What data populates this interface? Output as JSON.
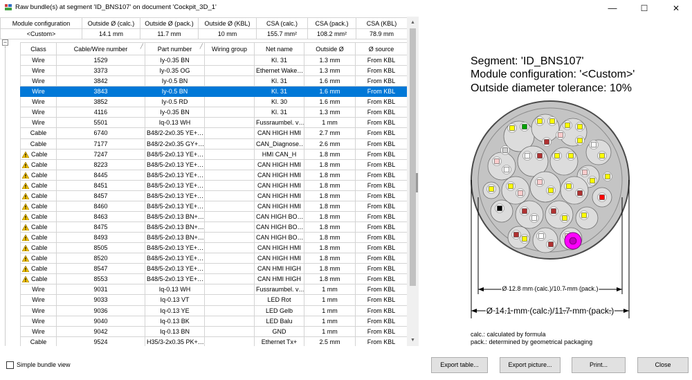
{
  "window": {
    "title": "Raw bundle(s) at segment 'ID_BNS107' on document 'Cockpit_3D_1'",
    "minimize_glyph": "—",
    "maximize_glyph": "☐",
    "close_glyph": "✕"
  },
  "summary": {
    "headers": [
      "Module configuration",
      "Outside Ø (calc.)",
      "Outside Ø (pack.)",
      "Outside Ø (KBL)",
      "CSA (calc.)",
      "CSA (pack.)",
      "CSA (KBL)"
    ],
    "row": [
      "<Custom>",
      "14.1 mm",
      "11.7 mm",
      "10 mm",
      "155.7 mm²",
      "108.2 mm²",
      "78.9 mm"
    ],
    "expander": "−"
  },
  "table": {
    "headers": [
      "Class",
      "Cable/Wire number",
      "Part number",
      "Wiring group",
      "Net name",
      "Outside Ø",
      "Ø source"
    ],
    "selected_index": 3,
    "rows": [
      {
        "warn": false,
        "cls": "Wire",
        "num": "1529",
        "part": "Iy-0.35 BN",
        "group": "",
        "net": "Kl. 31",
        "od": "1.3 mm",
        "src": "From KBL"
      },
      {
        "warn": false,
        "cls": "Wire",
        "num": "3373",
        "part": "Iy-0.35 OG",
        "group": "",
        "net": "Ethernet Wake…",
        "od": "1.3 mm",
        "src": "From KBL"
      },
      {
        "warn": false,
        "cls": "Wire",
        "num": "3842",
        "part": "Iy-0.5 BN",
        "group": "",
        "net": "Kl. 31",
        "od": "1.6 mm",
        "src": "From KBL"
      },
      {
        "warn": false,
        "cls": "Wire",
        "num": "3843",
        "part": "Iy-0.5 BN",
        "group": "",
        "net": "Kl. 31",
        "od": "1.6 mm",
        "src": "From KBL"
      },
      {
        "warn": false,
        "cls": "Wire",
        "num": "3852",
        "part": "Iy-0.5 RD",
        "group": "",
        "net": "Kl. 30",
        "od": "1.6 mm",
        "src": "From KBL"
      },
      {
        "warn": false,
        "cls": "Wire",
        "num": "4116",
        "part": "Iy-0.35 BN",
        "group": "",
        "net": "Kl. 31",
        "od": "1.3 mm",
        "src": "From KBL"
      },
      {
        "warn": false,
        "cls": "Wire",
        "num": "5501",
        "part": "Iq-0.13 WH",
        "group": "",
        "net": "Fussraumbel. v…",
        "od": "1 mm",
        "src": "From KBL"
      },
      {
        "warn": false,
        "cls": "Cable",
        "num": "6740",
        "part": "B48/2-2x0.35  YE+…",
        "group": "",
        "net": "CAN HIGH HMI",
        "od": "2.7 mm",
        "src": "From KBL"
      },
      {
        "warn": false,
        "cls": "Cable",
        "num": "7177",
        "part": "B48/2-2x0.35  GY+…",
        "group": "",
        "net": "CAN_Diagnose…",
        "od": "2.6 mm",
        "src": "From KBL"
      },
      {
        "warn": true,
        "cls": "Cable",
        "num": "7247",
        "part": "B48/5-2x0.13  YE+…",
        "group": "",
        "net": "HMI CAN_H",
        "od": "1.8 mm",
        "src": "From KBL"
      },
      {
        "warn": true,
        "cls": "Cable",
        "num": "8223",
        "part": "B48/5-2x0.13  YE+…",
        "group": "",
        "net": "CAN HIGH HMI",
        "od": "1.8 mm",
        "src": "From KBL"
      },
      {
        "warn": true,
        "cls": "Cable",
        "num": "8445",
        "part": "B48/5-2x0.13  YE+…",
        "group": "",
        "net": "CAN HIGH HMI",
        "od": "1.8 mm",
        "src": "From KBL"
      },
      {
        "warn": true,
        "cls": "Cable",
        "num": "8451",
        "part": "B48/5-2x0.13  YE+…",
        "group": "",
        "net": "CAN HIGH HMI",
        "od": "1.8 mm",
        "src": "From KBL"
      },
      {
        "warn": true,
        "cls": "Cable",
        "num": "8457",
        "part": "B48/5-2x0.13  YE+…",
        "group": "",
        "net": "CAN HIGH HMI",
        "od": "1.8 mm",
        "src": "From KBL"
      },
      {
        "warn": true,
        "cls": "Cable",
        "num": "8460",
        "part": "B48/5-2x0.13  YE+…",
        "group": "",
        "net": "CAN HIGH HMI",
        "od": "1.8 mm",
        "src": "From KBL"
      },
      {
        "warn": true,
        "cls": "Cable",
        "num": "8463",
        "part": "B48/5-2x0.13  BN+…",
        "group": "",
        "net": "CAN HIGH BO…",
        "od": "1.8 mm",
        "src": "From KBL"
      },
      {
        "warn": true,
        "cls": "Cable",
        "num": "8475",
        "part": "B48/5-2x0.13  BN+…",
        "group": "",
        "net": "CAN HIGH BO…",
        "od": "1.8 mm",
        "src": "From KBL"
      },
      {
        "warn": true,
        "cls": "Cable",
        "num": "8493",
        "part": "B48/5-2x0.13  BN+…",
        "group": "",
        "net": "CAN HIGH BO…",
        "od": "1.8 mm",
        "src": "From KBL"
      },
      {
        "warn": true,
        "cls": "Cable",
        "num": "8505",
        "part": "B48/5-2x0.13  YE+…",
        "group": "",
        "net": "CAN HIGH HMI",
        "od": "1.8 mm",
        "src": "From KBL"
      },
      {
        "warn": true,
        "cls": "Cable",
        "num": "8520",
        "part": "B48/5-2x0.13  YE+…",
        "group": "",
        "net": "CAN HIGH HMI",
        "od": "1.8 mm",
        "src": "From KBL"
      },
      {
        "warn": true,
        "cls": "Cable",
        "num": "8547",
        "part": "B48/5-2x0.13  YE+…",
        "group": "",
        "net": "CAN HMI HIGH",
        "od": "1.8 mm",
        "src": "From KBL"
      },
      {
        "warn": true,
        "cls": "Cable",
        "num": "8553",
        "part": "B48/5-2x0.13  YE+…",
        "group": "",
        "net": "CAN HMI HIGH",
        "od": "1.8 mm",
        "src": "From KBL"
      },
      {
        "warn": false,
        "cls": "Wire",
        "num": "9031",
        "part": "Iq-0.13 WH",
        "group": "",
        "net": "Fussraumbel. v…",
        "od": "1 mm",
        "src": "From KBL"
      },
      {
        "warn": false,
        "cls": "Wire",
        "num": "9033",
        "part": "Iq-0.13 VT",
        "group": "",
        "net": "LED Rot",
        "od": "1 mm",
        "src": "From KBL"
      },
      {
        "warn": false,
        "cls": "Wire",
        "num": "9036",
        "part": "Iq-0.13 YE",
        "group": "",
        "net": "LED Gelb",
        "od": "1 mm",
        "src": "From KBL"
      },
      {
        "warn": false,
        "cls": "Wire",
        "num": "9040",
        "part": "Iq-0.13 BK",
        "group": "",
        "net": "LED Balu",
        "od": "1 mm",
        "src": "From KBL"
      },
      {
        "warn": false,
        "cls": "Wire",
        "num": "9042",
        "part": "Iq-0.13 BN",
        "group": "",
        "net": "GND",
        "od": "1 mm",
        "src": "From KBL"
      },
      {
        "warn": false,
        "cls": "Cable",
        "num": "9524",
        "part": "H35/3-2x0.35  PK+…",
        "group": "",
        "net": "Ethernet Tx+",
        "od": "2.5 mm",
        "src": "From KBL"
      }
    ]
  },
  "scrollbar": {
    "up": "▲",
    "down": "▼"
  },
  "info": {
    "segment": "Segment: 'ID_BNS107'",
    "module": "Module configuration: '<Custom>'",
    "tolerance": "Outside diameter tolerance: 10%"
  },
  "drawing": {
    "inner_dim": "Ø 12.8 mm (calc.)/10.7 mm (pack.)",
    "outer_dim": "Ø 14.1 mm (calc.)/11.7 mm (pack.)",
    "bundle_colors": {
      "outer": "#555555",
      "fill": "#c8c8c8",
      "tube": "#dcdcdc",
      "highlight": "#ff00ff"
    }
  },
  "legend": {
    "calc": "calc.: calculated by formula",
    "pack": "pack.: determined by geometrical packaging"
  },
  "footer": {
    "simple_view": "Simple bundle view",
    "export_table": "Export table...",
    "export_picture": "Export picture...",
    "print": "Print...",
    "close": "Close"
  }
}
